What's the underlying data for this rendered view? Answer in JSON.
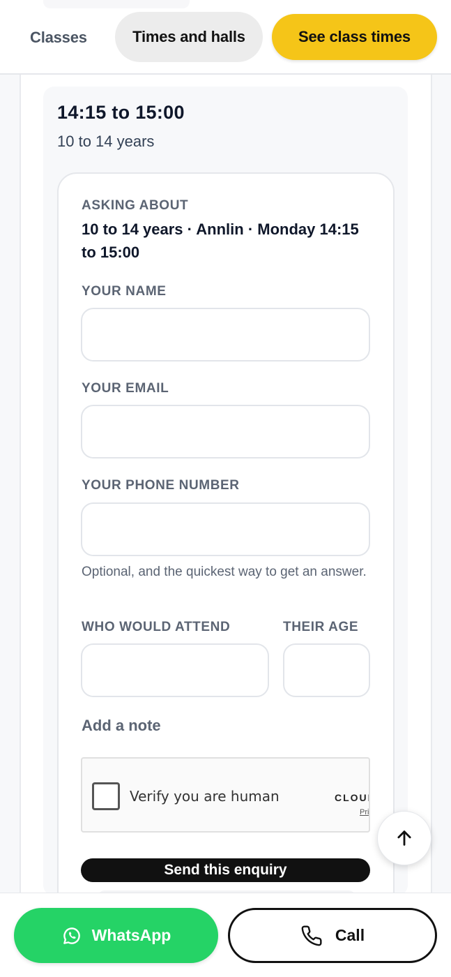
{
  "nav": {
    "classes_label": "Classes",
    "times_label": "Times and halls",
    "see_times_label": "See class times"
  },
  "session": {
    "time": "14:15 to 15:00",
    "age_range": "10 to 14 years"
  },
  "form": {
    "asking_label": "ASKING ABOUT",
    "asking_value": "10 to 14 years · Annlin · Monday 14:15 to 15:00",
    "name_label": "YOUR NAME",
    "name_value": "",
    "email_label": "YOUR EMAIL",
    "email_value": "",
    "phone_label": "YOUR PHONE NUMBER",
    "phone_value": "",
    "phone_helper": "Optional, and the quickest way to get an answer.",
    "attend_label": "WHO WOULD ATTEND",
    "attend_value": "",
    "age_label": "THEIR AGE",
    "age_value": "",
    "add_note_label": "Add a note",
    "submit_label": "Send this enquiry"
  },
  "captcha": {
    "label": "Verify you are human",
    "brand": "CLOUDFLARE",
    "privacy": "Privacy"
  },
  "bottom_bar": {
    "whatsapp_label": "WhatsApp",
    "call_label": "Call"
  },
  "colors": {
    "accent_yellow": "#f5c518",
    "whatsapp_green": "#25d366",
    "submit_black": "#111111"
  },
  "icons": [
    "whatsapp-icon",
    "phone-icon",
    "arrow-up-icon"
  ]
}
